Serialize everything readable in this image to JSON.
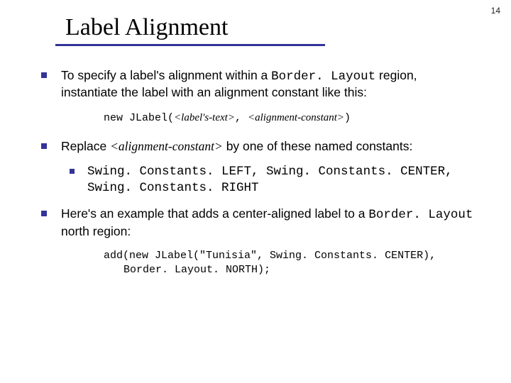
{
  "page_number": "14",
  "title": "Label Alignment",
  "b1_pre": "To specify a label's alignment within a ",
  "b1_code": "Border. Layout",
  "b1_post": " region, instantiate the label with an alignment constant like this:",
  "code1_pre": "new JLabel(",
  "code1_arg1": "<label's-text>",
  "code1_mid": ", ",
  "code1_arg2": "<alignment-constant>",
  "code1_post": ")",
  "b2_pre": "Replace ",
  "b2_italic": "<alignment-constant>",
  "b2_post": " by one of these named constants:",
  "b2sub": "Swing. Constants. LEFT, Swing. Constants. CENTER, Swing. Constants. RIGHT",
  "b3_pre": "Here's an example that adds a center-aligned label to a ",
  "b3_code": "Border. Layout",
  "b3_post": " north region:",
  "code2_l1": "add(new JLabel(\"Tunisia\", Swing. Constants. CENTER),",
  "code2_l2": "Border. Layout. NORTH);"
}
